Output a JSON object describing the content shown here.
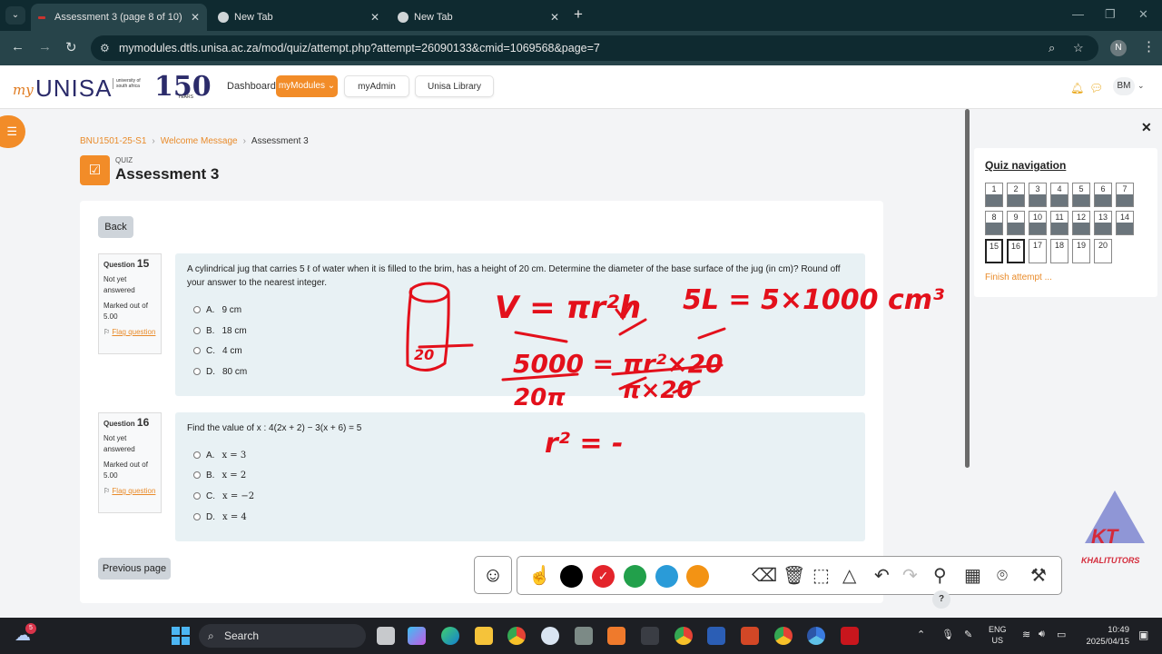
{
  "browser": {
    "tabs": [
      {
        "title": "Assessment 3 (page 8 of 10)",
        "active": true
      },
      {
        "title": "New Tab",
        "active": false
      },
      {
        "title": "New Tab",
        "active": false
      }
    ],
    "new_tab_icon": "+",
    "url": "mymodules.dtls.unisa.ac.za/mod/quiz/attempt.php?attempt=26090133&cmid=1069568&page=7",
    "profile_initial": "N"
  },
  "header": {
    "logo_my": "my",
    "logo_unisa": "UNISA",
    "logo_sub": "university of south africa",
    "logo_150": "150",
    "logo_years": "YEARS",
    "nav": {
      "dashboard": "Dashboard",
      "mymodules": "myModules",
      "myadmin": "myAdmin",
      "library": "Unisa Library"
    },
    "user_initials": "BM"
  },
  "breadcrumb": [
    "BNU1501-25-S1",
    "Welcome Message",
    "Assessment 3"
  ],
  "quiz": {
    "kind": "QUIZ",
    "title": "Assessment 3"
  },
  "buttons": {
    "back": "Back",
    "previous_page": "Previous page"
  },
  "questions": [
    {
      "label": "Question",
      "number": "15",
      "status": "Not yet answered",
      "marked": "Marked out of 5.00",
      "flag": "Flag question",
      "text": "A cylindrical jug that carries 5 ℓ of water when it is filled to the brim, has a height of 20 cm. Determine the diameter of the base surface of the jug (in cm)? Round off your answer to the nearest integer.",
      "options": [
        {
          "letter": "A.",
          "text": "9 cm"
        },
        {
          "letter": "B.",
          "text": "18 cm"
        },
        {
          "letter": "C.",
          "text": "4 cm"
        },
        {
          "letter": "D.",
          "text": "80 cm"
        }
      ]
    },
    {
      "label": "Question",
      "number": "16",
      "status": "Not yet answered",
      "marked": "Marked out of 5.00",
      "flag": "Flag question",
      "text": "Find the value of  x : 4(2x + 2) − 3(x + 6) = 5",
      "options": [
        {
          "letter": "A.",
          "text": "x = 3"
        },
        {
          "letter": "B.",
          "text": "x = 2"
        },
        {
          "letter": "C.",
          "text": "x = −2"
        },
        {
          "letter": "D.",
          "text": "x = 4"
        }
      ]
    }
  ],
  "quiz_navigation": {
    "title": "Quiz navigation",
    "items": [
      {
        "n": "1",
        "state": "answered"
      },
      {
        "n": "2",
        "state": "answered"
      },
      {
        "n": "3",
        "state": "answered"
      },
      {
        "n": "4",
        "state": "answered"
      },
      {
        "n": "5",
        "state": "answered"
      },
      {
        "n": "6",
        "state": "answered"
      },
      {
        "n": "7",
        "state": "answered"
      },
      {
        "n": "8",
        "state": "answered"
      },
      {
        "n": "9",
        "state": "answered"
      },
      {
        "n": "10",
        "state": "answered"
      },
      {
        "n": "11",
        "state": "answered"
      },
      {
        "n": "12",
        "state": "answered"
      },
      {
        "n": "13",
        "state": "answered"
      },
      {
        "n": "14",
        "state": "answered"
      },
      {
        "n": "15",
        "state": "current"
      },
      {
        "n": "16",
        "state": "current"
      },
      {
        "n": "17",
        "state": "unanswered"
      },
      {
        "n": "18",
        "state": "unanswered"
      },
      {
        "n": "19",
        "state": "unanswered"
      },
      {
        "n": "20",
        "state": "unanswered"
      }
    ],
    "finish": "Finish attempt ..."
  },
  "annotation_toolbar": {
    "emoji_icon": "smiley-icon",
    "colors": [
      "#000000",
      "#e3242b",
      "#22a04b",
      "#2a9bd8",
      "#f39314"
    ],
    "selected_color": "#e3242b",
    "tools": [
      "pointer-icon",
      "eraser-icon",
      "trash-icon",
      "select-icon",
      "shapes-icon",
      "undo-icon",
      "redo-icon",
      "pin-icon",
      "calendar-icon",
      "camera-icon",
      "wrench-icon"
    ]
  },
  "help_label": "?",
  "watermark": {
    "logo": "KT",
    "brand": "KHALITUTORS"
  },
  "handwriting": {
    "line1": "V = πr²h",
    "line2": "5L = 5×1000 cm³",
    "line3_num": "5000 = πr²×20",
    "line3_den_left": "20π",
    "line3_den_right": "π×20",
    "line4": "r² = -",
    "cyl_label": "20"
  },
  "taskbar": {
    "weather_badge": "5",
    "search": "Search",
    "lang1": "ENG",
    "lang2": "US",
    "time": "10:49",
    "date": "2025/04/15"
  }
}
